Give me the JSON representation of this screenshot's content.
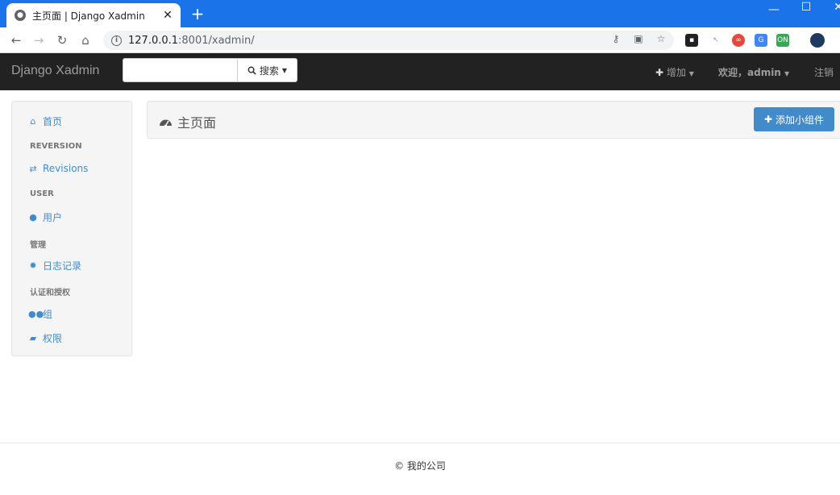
{
  "browser": {
    "tab_title": "主页面 | Django Xadmin",
    "url_host": "127.0.0.1",
    "url_path": ":8001/xadmin/"
  },
  "navbar": {
    "brand": "Django Xadmin",
    "search_placeholder": "",
    "search_button": "搜索",
    "add_label": "增加",
    "welcome_label": "欢迎，admin",
    "logout_label": "注销"
  },
  "sidebar": {
    "items": [
      {
        "type": "link",
        "label": "首页",
        "icon": "home-icon"
      },
      {
        "type": "header",
        "label": "REVERSION"
      },
      {
        "type": "link",
        "label": "Revisions",
        "icon": "exchange-icon"
      },
      {
        "type": "header",
        "label": "USER"
      },
      {
        "type": "link",
        "label": "用户",
        "icon": "user-icon"
      },
      {
        "type": "header",
        "label": "管理"
      },
      {
        "type": "link",
        "label": "日志记录",
        "icon": "cog-icon"
      },
      {
        "type": "header",
        "label": "认证和授权"
      },
      {
        "type": "link",
        "label": "组",
        "icon": "group-icon"
      },
      {
        "type": "link",
        "label": "权限",
        "icon": "lock-icon"
      }
    ]
  },
  "main": {
    "title": "主页面",
    "add_widget_label": "添加小组件"
  },
  "footer": {
    "text": "© 我的公司"
  },
  "colors": {
    "navbar_bg": "#222222",
    "link": "#428bca",
    "primary_button": "#428bca",
    "chrome_blue": "#1a73e8"
  }
}
